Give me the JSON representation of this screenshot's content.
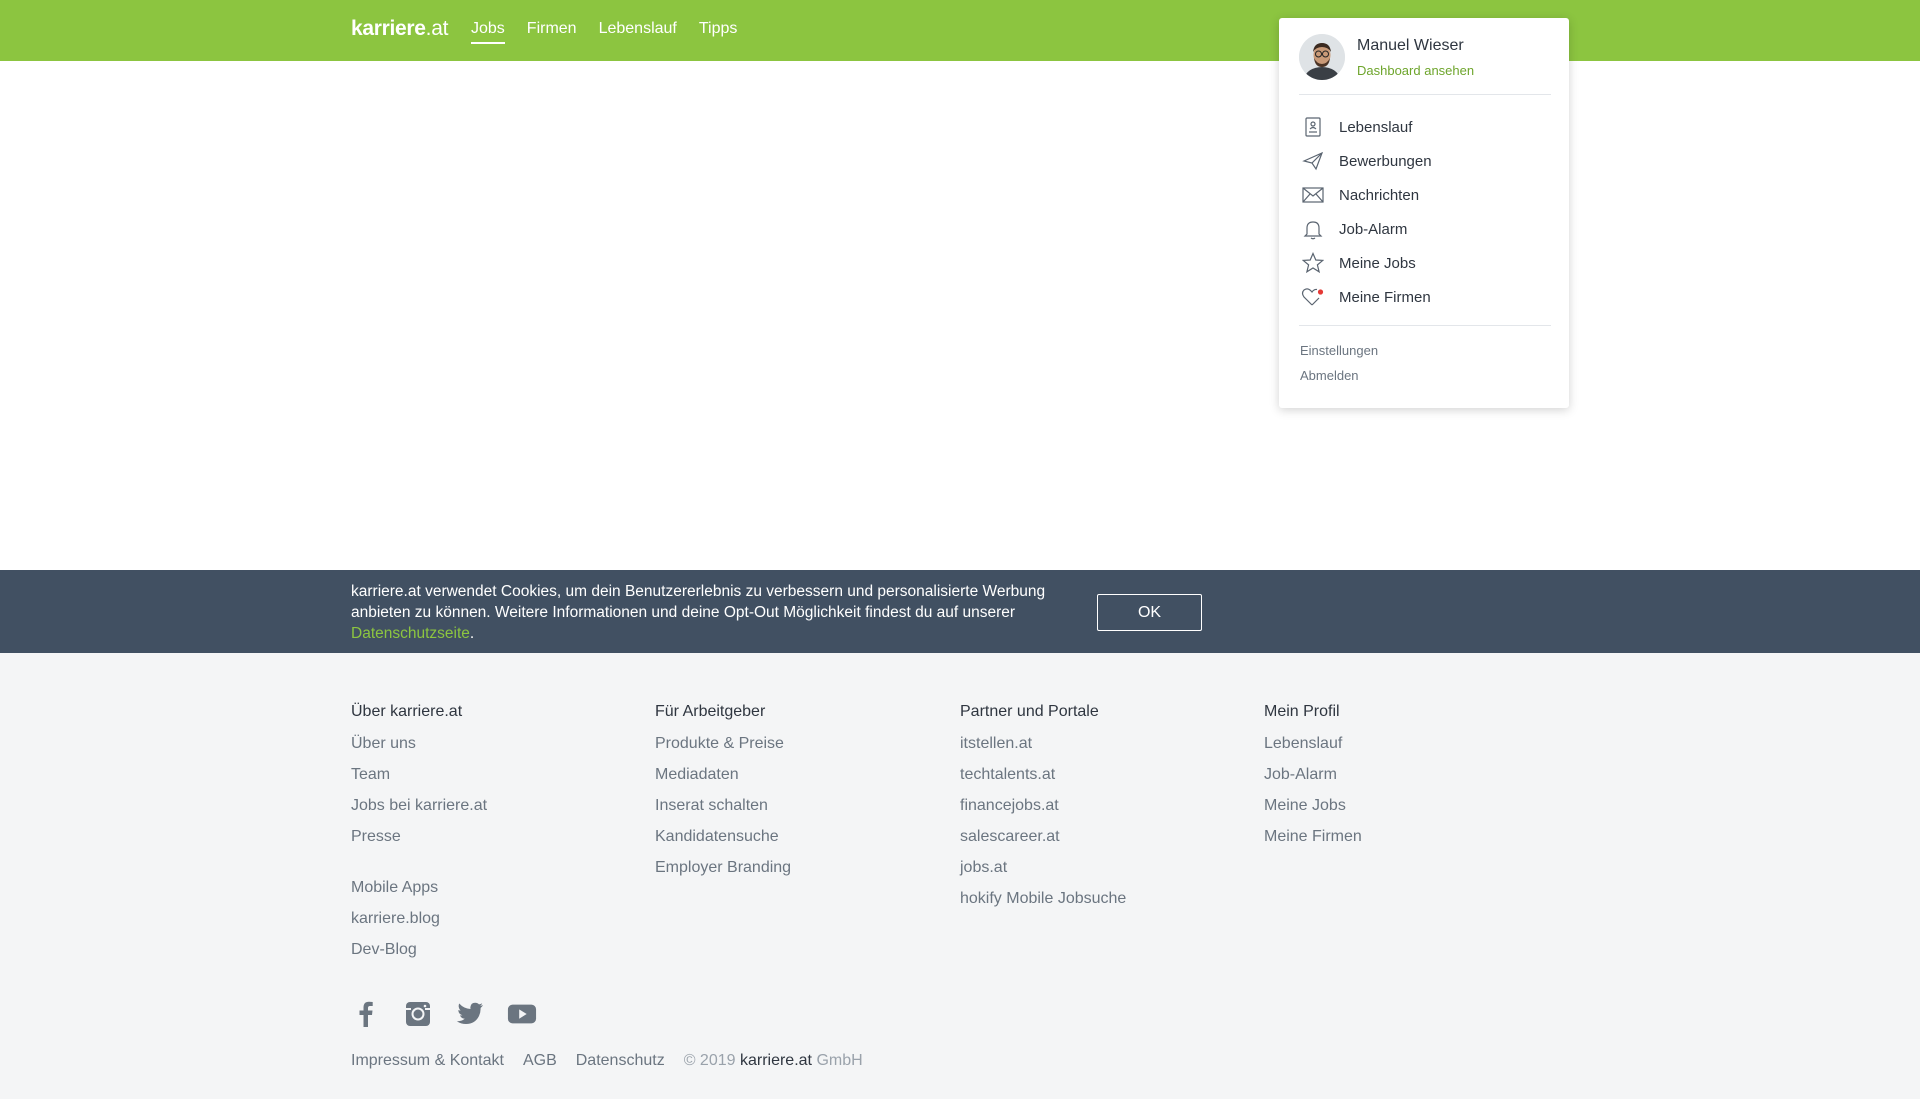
{
  "header": {
    "logo_main": "karriere",
    "logo_tld": ".at",
    "nav": [
      "Jobs",
      "Firmen",
      "Lebenslauf",
      "Tipps"
    ],
    "active_nav": "Jobs",
    "color": "#8cc540"
  },
  "dropdown": {
    "user_name": "Manuel Wieser",
    "dashboard_link": "Dashboard ansehen",
    "items": [
      {
        "label": "Lebenslauf",
        "icon": "document-icon"
      },
      {
        "label": "Bewerbungen",
        "icon": "paper-plane-icon"
      },
      {
        "label": "Nachrichten",
        "icon": "envelope-icon"
      },
      {
        "label": "Job-Alarm",
        "icon": "bell-icon"
      },
      {
        "label": "Meine Jobs",
        "icon": "star-icon"
      },
      {
        "label": "Meine Firmen",
        "icon": "heart-icon"
      }
    ],
    "settings": "Einstellungen",
    "logout": "Abmelden"
  },
  "cookie": {
    "text": "karriere.at verwendet Cookies, um dein Benutzererlebnis zu verbessern und personalisierte Werbung anbieten zu können. Weitere Informationen und deine Opt-Out Möglichkeit findest du auf unserer ",
    "link": "Datenschutzseite",
    "end": ".",
    "ok": "OK",
    "background": "#415062"
  },
  "footer": {
    "columns": [
      {
        "title": "Über karriere.at",
        "links": [
          "Über uns",
          "Team",
          "Jobs bei karriere.at",
          "Presse"
        ],
        "extra_links": [
          "Mobile Apps",
          "karriere.blog",
          "Dev-Blog"
        ]
      },
      {
        "title": "Für Arbeitgeber",
        "links": [
          "Produkte & Preise",
          "Mediadaten",
          "Inserat schalten",
          "Kandidatensuche",
          "Employer Branding"
        ]
      },
      {
        "title": "Partner und Portale",
        "links": [
          "itstellen.at",
          "techtalents.at",
          "financejobs.at",
          "salescareer.at",
          "jobs.at",
          "hokify Mobile Jobsuche"
        ]
      },
      {
        "title": "Mein Profil",
        "links": [
          "Lebenslauf",
          "Job-Alarm",
          "Meine Jobs",
          "Meine Firmen"
        ]
      }
    ],
    "socials": [
      "facebook-icon",
      "instagram-icon",
      "twitter-icon",
      "youtube-icon"
    ],
    "bottom_links": [
      "Impressum & Kontakt",
      "AGB",
      "Datenschutz"
    ],
    "copyright_prefix": "© 2019 ",
    "copyright_brand": "karriere.at",
    "copyright_suffix": " GmbH"
  }
}
